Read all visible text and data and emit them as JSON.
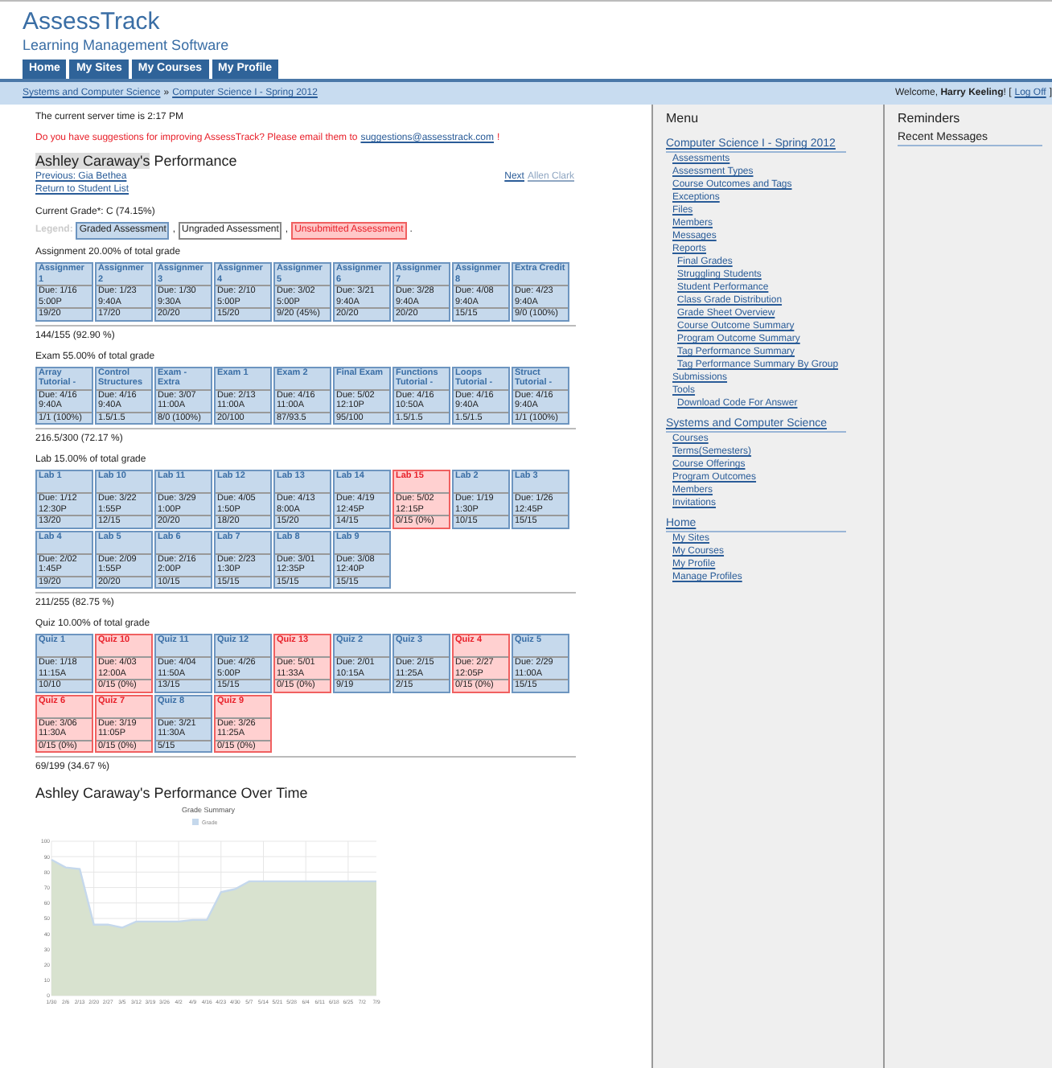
{
  "header": {
    "title": "AssessTrack",
    "subtitle": "Learning Management Software",
    "tabs": [
      "Home",
      "My Sites",
      "My Courses",
      "My Profile"
    ]
  },
  "breadcrumb": {
    "items": [
      "Systems and Computer Science",
      "Computer Science I - Spring 2012"
    ],
    "separator": "»",
    "welcome": "Welcome, **Harry Keeling**! [",
    "logoff": "Log Off",
    "logoff_end": "]"
  },
  "server_time": "The current server time is 2:17 PM",
  "suggestion": {
    "text": "Do you have suggestions for improving AssessTrack? Please email them to",
    "email": "suggestions@assesstrack.com",
    "end": "!"
  },
  "student": {
    "name": "Ashley Caraway's",
    "heading": "Performance",
    "previous": "Previous: Gia Bethea",
    "return": "Return to Student List",
    "next": "Next",
    "next_name": "Allen Clark",
    "grade": "Current Grade*: C (74.15%)"
  },
  "legend": {
    "label": "Legend:",
    "items": [
      {
        "label": "Graded Assessment",
        "kind": "graded",
        "after": ","
      },
      {
        "label": "Ungraded Assessment",
        "kind": "ungraded",
        "after": ","
      },
      {
        "label": "Unsubmitted Assessment",
        "kind": "unsubmitted",
        "after": "."
      }
    ]
  },
  "sections": [
    {
      "title": "Assignment 20.00% of total grade",
      "total": "144/155 (92.90 %)",
      "items": [
        {
          "name": "Assignmer 1",
          "due": "Due: 1/16",
          "time": "5:00P",
          "score": "19/20",
          "kind": "graded"
        },
        {
          "name": "Assignmer 2",
          "due": "Due: 1/23",
          "time": "9:40A",
          "score": "17/20",
          "kind": "graded"
        },
        {
          "name": "Assignmer 3",
          "due": "Due: 1/30",
          "time": "9:30A",
          "score": "20/20",
          "kind": "graded"
        },
        {
          "name": "Assignmer 4",
          "due": "Due: 2/10",
          "time": "5:00P",
          "score": "15/20",
          "kind": "graded"
        },
        {
          "name": "Assignmer 5",
          "due": "Due: 3/02",
          "time": "5:00P",
          "score": "9/20 (45%)",
          "kind": "graded"
        },
        {
          "name": "Assignmer 6",
          "due": "Due: 3/21",
          "time": "9:40A",
          "score": "20/20",
          "kind": "graded"
        },
        {
          "name": "Assignmer 7",
          "due": "Due: 3/28",
          "time": "9:40A",
          "score": "20/20",
          "kind": "graded"
        },
        {
          "name": "Assignmer 8",
          "due": "Due: 4/08",
          "time": "9:40A",
          "score": "15/15",
          "kind": "graded"
        },
        {
          "name": "Extra Credit",
          "due": "Due: 4/23",
          "time": "9:40A",
          "score": "9/0 (100%)",
          "kind": "graded"
        }
      ]
    },
    {
      "title": "Exam 55.00% of total grade",
      "total": "216.5/300 (72.17 %)",
      "items": [
        {
          "name": "Array Tutorial -",
          "due": "Due: 4/16",
          "time": "9:40A",
          "score": "1/1 (100%)",
          "kind": "graded"
        },
        {
          "name": "Control Structures",
          "due": "Due: 4/16",
          "time": "9:40A",
          "score": "1.5/1.5",
          "kind": "graded"
        },
        {
          "name": "Exam - Extra",
          "due": "Due: 3/07",
          "time": "11:00A",
          "score": "8/0 (100%)",
          "kind": "graded"
        },
        {
          "name": "Exam 1",
          "due": "Due: 2/13",
          "time": "11:00A",
          "score": "20/100",
          "kind": "graded"
        },
        {
          "name": "Exam 2",
          "due": "Due: 4/16",
          "time": "11:00A",
          "score": "87/93.5",
          "kind": "graded"
        },
        {
          "name": "Final Exam",
          "due": "Due: 5/02",
          "time": "12:10P",
          "score": "95/100",
          "kind": "graded"
        },
        {
          "name": "Functions Tutorial -",
          "due": "Due: 4/16",
          "time": "10:50A",
          "score": "1.5/1.5",
          "kind": "graded"
        },
        {
          "name": "Loops Tutorial -",
          "due": "Due: 4/16",
          "time": "9:40A",
          "score": "1.5/1.5",
          "kind": "graded"
        },
        {
          "name": "Struct Tutorial -",
          "due": "Due: 4/16",
          "time": "9:40A",
          "score": "1/1 (100%)",
          "kind": "graded"
        }
      ]
    },
    {
      "title": "Lab 15.00% of total grade",
      "total": "211/255 (82.75 %)",
      "items": [
        {
          "name": "Lab 1",
          "due": "Due: 1/12",
          "time": "12:30P",
          "score": "13/20",
          "kind": "graded"
        },
        {
          "name": "Lab 10",
          "due": "Due: 3/22",
          "time": "1:55P",
          "score": "12/15",
          "kind": "graded"
        },
        {
          "name": "Lab 11",
          "due": "Due: 3/29",
          "time": "1:00P",
          "score": "20/20",
          "kind": "graded"
        },
        {
          "name": "Lab 12",
          "due": "Due: 4/05",
          "time": "1:50P",
          "score": "18/20",
          "kind": "graded"
        },
        {
          "name": "Lab 13",
          "due": "Due: 4/13",
          "time": "8:00A",
          "score": "15/20",
          "kind": "graded"
        },
        {
          "name": "Lab 14",
          "due": "Due: 4/19",
          "time": "12:45P",
          "score": "14/15",
          "kind": "graded"
        },
        {
          "name": "Lab 15",
          "due": "Due: 5/02",
          "time": "12:15P",
          "score": "0/15 (0%)",
          "kind": "unsubmitted"
        },
        {
          "name": "Lab 2",
          "due": "Due: 1/19",
          "time": "1:30P",
          "score": "10/15",
          "kind": "graded"
        },
        {
          "name": "Lab 3",
          "due": "Due: 1/26",
          "time": "12:45P",
          "score": "15/15",
          "kind": "graded"
        },
        {
          "name": "Lab 4",
          "due": "Due: 2/02",
          "time": "1:45P",
          "score": "19/20",
          "kind": "graded"
        },
        {
          "name": "Lab 5",
          "due": "Due: 2/09",
          "time": "1:55P",
          "score": "20/20",
          "kind": "graded"
        },
        {
          "name": "Lab 6",
          "due": "Due: 2/16",
          "time": "2:00P",
          "score": "10/15",
          "kind": "graded"
        },
        {
          "name": "Lab 7",
          "due": "Due: 2/23",
          "time": "1:30P",
          "score": "15/15",
          "kind": "graded"
        },
        {
          "name": "Lab 8",
          "due": "Due: 3/01",
          "time": "12:35P",
          "score": "15/15",
          "kind": "graded"
        },
        {
          "name": "Lab 9",
          "due": "Due: 3/08",
          "time": "12:40P",
          "score": "15/15",
          "kind": "graded"
        }
      ]
    },
    {
      "title": "Quiz 10.00% of total grade",
      "total": "69/199 (34.67 %)",
      "items": [
        {
          "name": "Quiz 1",
          "due": "Due: 1/18",
          "time": "11:15A",
          "score": "10/10",
          "kind": "graded"
        },
        {
          "name": "Quiz 10",
          "due": "Due: 4/03",
          "time": "12:00A",
          "score": "0/15 (0%)",
          "kind": "unsubmitted"
        },
        {
          "name": "Quiz 11",
          "due": "Due: 4/04",
          "time": "11:50A",
          "score": "13/15",
          "kind": "graded"
        },
        {
          "name": "Quiz 12",
          "due": "Due: 4/26",
          "time": "5:00P",
          "score": "15/15",
          "kind": "graded"
        },
        {
          "name": "Quiz 13",
          "due": "Due: 5/01",
          "time": "11:33A",
          "score": "0/15 (0%)",
          "kind": "unsubmitted"
        },
        {
          "name": "Quiz 2",
          "due": "Due: 2/01",
          "time": "10:15A",
          "score": "9/19",
          "kind": "graded"
        },
        {
          "name": "Quiz 3",
          "due": "Due: 2/15",
          "time": "11:25A",
          "score": "2/15",
          "kind": "graded"
        },
        {
          "name": "Quiz 4",
          "due": "Due: 2/27",
          "time": "12:05P",
          "score": "0/15 (0%)",
          "kind": "unsubmitted"
        },
        {
          "name": "Quiz 5",
          "due": "Due: 2/29",
          "time": "11:00A",
          "score": "15/15",
          "kind": "graded"
        },
        {
          "name": "Quiz 6",
          "due": "Due: 3/06",
          "time": "11:30A",
          "score": "0/15 (0%)",
          "kind": "unsubmitted"
        },
        {
          "name": "Quiz 7",
          "due": "Due: 3/19",
          "time": "11:05P",
          "score": "0/15 (0%)",
          "kind": "unsubmitted"
        },
        {
          "name": "Quiz 8",
          "due": "Due: 3/21",
          "time": "11:30A",
          "score": "5/15",
          "kind": "graded"
        },
        {
          "name": "Quiz 9",
          "due": "Due: 3/26",
          "time": "11:25A",
          "score": "0/15 (0%)",
          "kind": "unsubmitted"
        }
      ]
    }
  ],
  "performance": {
    "title": "Ashley Caraway's Performance Over Time",
    "chart_data": {
      "type": "area",
      "title": "Grade Summary",
      "categories": [
        "1/30",
        "2/6",
        "2/13",
        "2/20",
        "2/27",
        "3/5",
        "3/12",
        "3/19",
        "3/26",
        "4/2",
        "4/9",
        "4/16",
        "4/23",
        "4/30",
        "5/7",
        "5/14",
        "5/21",
        "5/28",
        "6/4",
        "6/11",
        "6/18",
        "6/25",
        "7/2",
        "7/9"
      ],
      "ylim": [
        0,
        100
      ],
      "yticks": [
        0,
        10,
        20,
        30,
        40,
        50,
        60,
        70,
        80,
        90,
        100
      ],
      "grid": true,
      "series": [
        {
          "name": "Grade",
          "color": "#c5d8ec",
          "values": [
            88,
            83,
            82,
            46,
            46,
            44,
            48,
            48,
            48,
            48,
            49,
            49,
            67,
            69,
            74,
            74,
            74,
            74,
            74,
            74,
            74,
            74,
            74,
            74
          ]
        }
      ]
    }
  },
  "menu": {
    "title": "Menu",
    "groups": [
      {
        "title": "Computer Science I - Spring 2012",
        "links": [
          {
            "label": "Assessments"
          },
          {
            "label": "Assessment Types"
          },
          {
            "label": "Course Outcomes and Tags"
          },
          {
            "label": "Exceptions"
          },
          {
            "label": "Files"
          },
          {
            "label": "Members"
          },
          {
            "label": "Messages"
          },
          {
            "label": "Reports",
            "children": [
              {
                "label": "Final Grades"
              },
              {
                "label": "Struggling Students"
              },
              {
                "label": "Student Performance"
              },
              {
                "label": "Class Grade Distribution"
              },
              {
                "label": "Grade Sheet Overview"
              },
              {
                "label": "Course Outcome Summary"
              },
              {
                "label": "Program Outcome Summary"
              },
              {
                "label": "Tag Performance Summary"
              },
              {
                "label": "Tag Performance Summary By Group"
              }
            ]
          },
          {
            "label": "Submissions"
          },
          {
            "label": "Tools",
            "children": [
              {
                "label": "Download Code For Answer"
              }
            ]
          }
        ]
      },
      {
        "title": "Systems and Computer Science",
        "links": [
          {
            "label": "Courses"
          },
          {
            "label": "Terms(Semesters)"
          },
          {
            "label": "Course Offerings"
          },
          {
            "label": "Program Outcomes"
          },
          {
            "label": "Members"
          },
          {
            "label": "Invitations"
          }
        ]
      },
      {
        "title": "Home",
        "links": [
          {
            "label": "My Sites"
          },
          {
            "label": "My Courses"
          },
          {
            "label": "My Profile"
          },
          {
            "label": "Manage Profiles"
          }
        ]
      }
    ]
  },
  "reminders": {
    "title": "Reminders",
    "subtitle": "Recent Messages"
  }
}
